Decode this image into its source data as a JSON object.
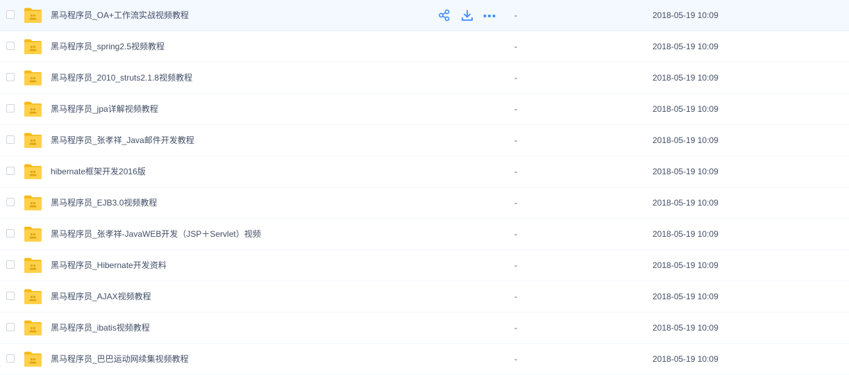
{
  "colors": {
    "folder": "#ffd04b",
    "folder_dark": "#f5b914",
    "action_icon": "#3b8cff",
    "text": "#424e67",
    "hover_row": "#f4f8ff"
  },
  "files": [
    {
      "name": "黑马程序员_OA+工作流实战视频教程",
      "size": "-",
      "modified": "2018-05-19 10:09",
      "icon": "folder-icon",
      "hovered": true
    },
    {
      "name": "黑马程序员_spring2.5视频教程",
      "size": "-",
      "modified": "2018-05-19 10:09",
      "icon": "folder-icon"
    },
    {
      "name": "黑马程序员_2010_struts2.1.8视频教程",
      "size": "-",
      "modified": "2018-05-19 10:09",
      "icon": "folder-icon"
    },
    {
      "name": "黑马程序员_jpa详解视频教程",
      "size": "-",
      "modified": "2018-05-19 10:09",
      "icon": "folder-icon"
    },
    {
      "name": "黑马程序员_张孝祥_Java邮件开发教程",
      "size": "-",
      "modified": "2018-05-19 10:09",
      "icon": "folder-icon"
    },
    {
      "name": "hibernate框架开发2016版",
      "size": "-",
      "modified": "2018-05-19 10:09",
      "icon": "folder-icon"
    },
    {
      "name": "黑马程序员_EJB3.0视频教程",
      "size": "-",
      "modified": "2018-05-19 10:09",
      "icon": "folder-icon"
    },
    {
      "name": "黑马程序员_张孝祥-JavaWEB开发（JSP＋Servlet）视频",
      "size": "-",
      "modified": "2018-05-19 10:09",
      "icon": "folder-icon"
    },
    {
      "name": "黑马程序员_Hibernate开发资料",
      "size": "-",
      "modified": "2018-05-19 10:09",
      "icon": "folder-icon"
    },
    {
      "name": "黑马程序员_AJAX视频教程",
      "size": "-",
      "modified": "2018-05-19 10:09",
      "icon": "folder-icon"
    },
    {
      "name": "黑马程序员_ibatis视频教程",
      "size": "-",
      "modified": "2018-05-19 10:09",
      "icon": "folder-icon"
    },
    {
      "name": "黑马程序员_巴巴运动网续集视频教程",
      "size": "-",
      "modified": "2018-05-19 10:09",
      "icon": "folder-icon"
    }
  ],
  "row_actions": [
    "share-icon",
    "download-icon",
    "more-icon"
  ]
}
